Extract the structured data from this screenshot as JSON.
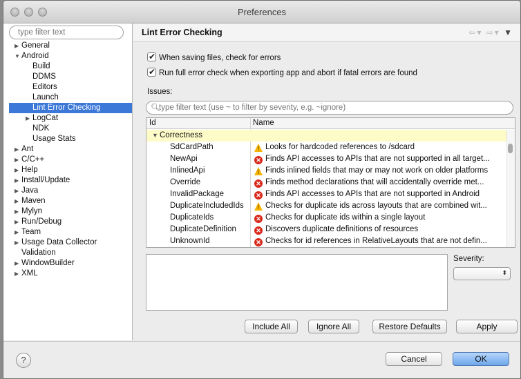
{
  "window": {
    "title": "Preferences"
  },
  "sidebar": {
    "filter_placeholder": "type filter text",
    "items": [
      {
        "label": "General",
        "level": 0,
        "twisty": "▶",
        "selected": false
      },
      {
        "label": "Android",
        "level": 0,
        "twisty": "▼",
        "selected": false
      },
      {
        "label": "Build",
        "level": 1,
        "twisty": "",
        "selected": false
      },
      {
        "label": "DDMS",
        "level": 1,
        "twisty": "",
        "selected": false
      },
      {
        "label": "Editors",
        "level": 1,
        "twisty": "",
        "selected": false
      },
      {
        "label": "Launch",
        "level": 1,
        "twisty": "",
        "selected": false
      },
      {
        "label": "Lint Error Checking",
        "level": 1,
        "twisty": "",
        "selected": true
      },
      {
        "label": "LogCat",
        "level": 1,
        "twisty": "▶",
        "selected": false
      },
      {
        "label": "NDK",
        "level": 1,
        "twisty": "",
        "selected": false
      },
      {
        "label": "Usage Stats",
        "level": 1,
        "twisty": "",
        "selected": false
      },
      {
        "label": "Ant",
        "level": 0,
        "twisty": "▶",
        "selected": false
      },
      {
        "label": "C/C++",
        "level": 0,
        "twisty": "▶",
        "selected": false
      },
      {
        "label": "Help",
        "level": 0,
        "twisty": "▶",
        "selected": false
      },
      {
        "label": "Install/Update",
        "level": 0,
        "twisty": "▶",
        "selected": false
      },
      {
        "label": "Java",
        "level": 0,
        "twisty": "▶",
        "selected": false
      },
      {
        "label": "Maven",
        "level": 0,
        "twisty": "▶",
        "selected": false
      },
      {
        "label": "Mylyn",
        "level": 0,
        "twisty": "▶",
        "selected": false
      },
      {
        "label": "Run/Debug",
        "level": 0,
        "twisty": "▶",
        "selected": false
      },
      {
        "label": "Team",
        "level": 0,
        "twisty": "▶",
        "selected": false
      },
      {
        "label": "Usage Data Collector",
        "level": 0,
        "twisty": "▶",
        "selected": false
      },
      {
        "label": "Validation",
        "level": 0,
        "twisty": "",
        "selected": false
      },
      {
        "label": "WindowBuilder",
        "level": 0,
        "twisty": "▶",
        "selected": false
      },
      {
        "label": "XML",
        "level": 0,
        "twisty": "▶",
        "selected": false
      }
    ]
  },
  "page": {
    "title": "Lint Error Checking",
    "checkbox_save": "When saving files, check for errors",
    "checkbox_export": "Run full error check when exporting app and abort if fatal errors are found",
    "issues_label": "Issues:",
    "issue_filter_placeholder": "type filter text (use ~ to filter by severity, e.g. ~ignore)",
    "columns": {
      "id": "Id",
      "name": "Name"
    },
    "category": "Correctness",
    "rows": [
      {
        "id": "SdCardPath",
        "severity": "warning",
        "name": "Looks for hardcoded references to /sdcard"
      },
      {
        "id": "NewApi",
        "severity": "error",
        "name": "Finds API accesses to APIs that are not supported in all target..."
      },
      {
        "id": "InlinedApi",
        "severity": "warning",
        "name": "Finds inlined fields that may or may not work on older platforms"
      },
      {
        "id": "Override",
        "severity": "error",
        "name": "Finds method declarations that will accidentally override met..."
      },
      {
        "id": "InvalidPackage",
        "severity": "error",
        "name": "Finds API accesses to APIs that are not supported in Android"
      },
      {
        "id": "DuplicateIncludedIds",
        "severity": "warning",
        "name": "Checks for duplicate ids across layouts that are combined wit..."
      },
      {
        "id": "DuplicateIds",
        "severity": "error",
        "name": "Checks for duplicate ids within a single layout"
      },
      {
        "id": "DuplicateDefinition",
        "severity": "error",
        "name": "Discovers duplicate definitions of resources"
      },
      {
        "id": "UnknownId",
        "severity": "error",
        "name": "Checks for id references in RelativeLayouts that are not defin..."
      }
    ],
    "severity_label": "Severity:",
    "severity_value": "",
    "buttons": {
      "include_all": "Include All",
      "ignore_all": "Ignore All",
      "restore_defaults": "Restore Defaults",
      "apply": "Apply"
    }
  },
  "footer": {
    "help": "?",
    "cancel": "Cancel",
    "ok": "OK"
  },
  "colors": {
    "selection": "#3c78d8",
    "category_row": "#fdfbc8",
    "error_icon": "#d9281a",
    "warning_icon": "#f4b400",
    "ok_button": "#6ea6ea"
  }
}
